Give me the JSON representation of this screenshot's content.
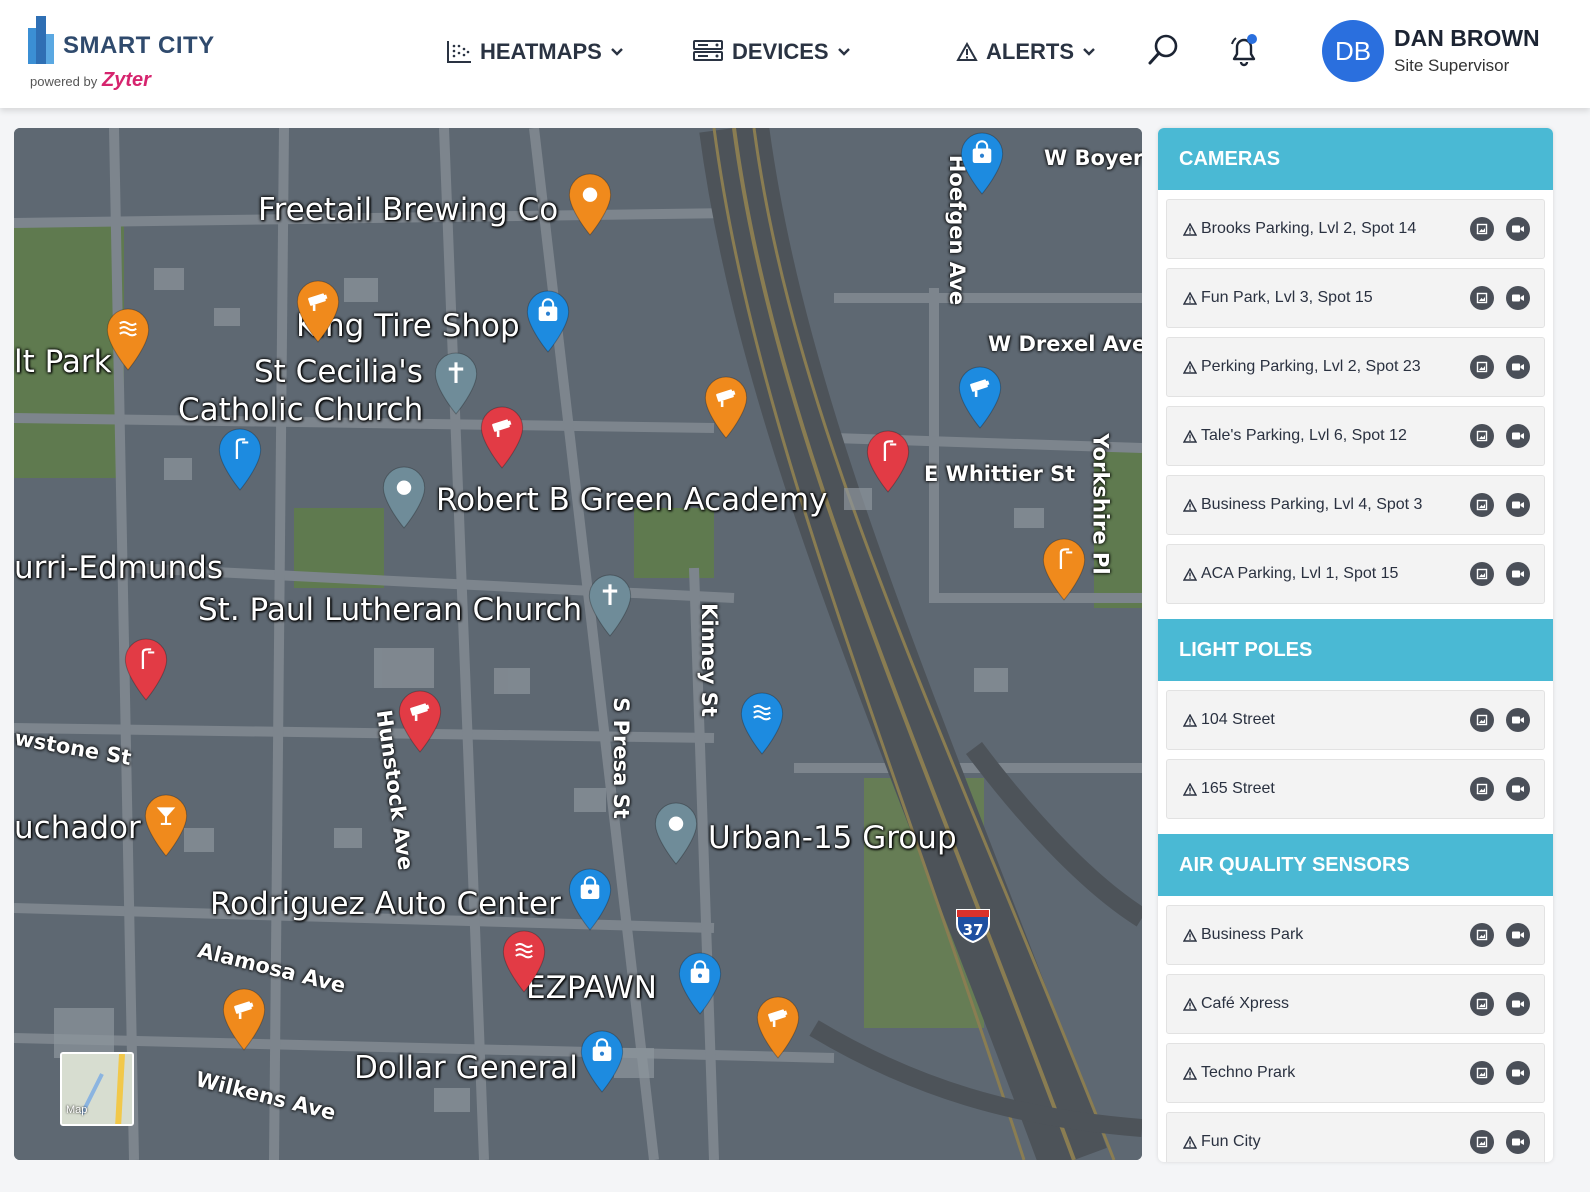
{
  "header": {
    "logo_title": "SMART CITY",
    "powered_by": "powered by",
    "brand": "Zyter",
    "nav": [
      {
        "label": "HEATMAPS",
        "icon": "heatmap-icon"
      },
      {
        "label": "DEVICES",
        "icon": "devices-icon"
      },
      {
        "label": "ALERTS",
        "icon": "alert-triangle-icon"
      }
    ],
    "user": {
      "initials": "DB",
      "name": "DAN BROWN",
      "role": "Site Supervisor"
    }
  },
  "map": {
    "places": [
      "Freetail Brewing Co",
      "King Tire Shop",
      "St Cecilia's",
      "Catholic Church",
      "Robert B Green Academy",
      "St. Paul Lutheran Church",
      "Urban-15 Group",
      "Rodriguez Auto Center",
      "EZPAWN",
      "Dollar General",
      "lt Park",
      "urri-Edmunds",
      "uchador"
    ],
    "streets": [
      "W Boyer",
      "Hoefgen Ave",
      "W Drexel Ave",
      "E Whittier St",
      "Yorkshire Pl",
      "Kinney St",
      "S Presa St",
      "Hunstock Ave",
      "wstone St",
      "Alamosa Ave",
      "Wilkens Ave"
    ],
    "highway_shield": "37",
    "map_toggle_label": "Map",
    "colors": {
      "orange": "#f08a1c",
      "red": "#e23b45",
      "blue": "#1d8be0",
      "gray": "#6f8c99"
    }
  },
  "panel": {
    "cameras": {
      "title": "CAMERAS",
      "items": [
        "Brooks Parking, Lvl 2, Spot 14",
        "Fun Park, Lvl 3, Spot 15",
        "Perking Parking, Lvl 2, Spot 23",
        "Tale's Parking, Lvl 6, Spot 12",
        "Business Parking, Lvl 4, Spot 3",
        "ACA Parking, Lvl 1, Spot 15"
      ]
    },
    "light_poles": {
      "title": "LIGHT POLES",
      "items": [
        "104 Street",
        "165 Street"
      ]
    },
    "air_quality": {
      "title": "AIR QUALITY SENSORS",
      "items": [
        "Business Park",
        "Café Xpress",
        "Techno Prark",
        "Fun City"
      ]
    }
  }
}
